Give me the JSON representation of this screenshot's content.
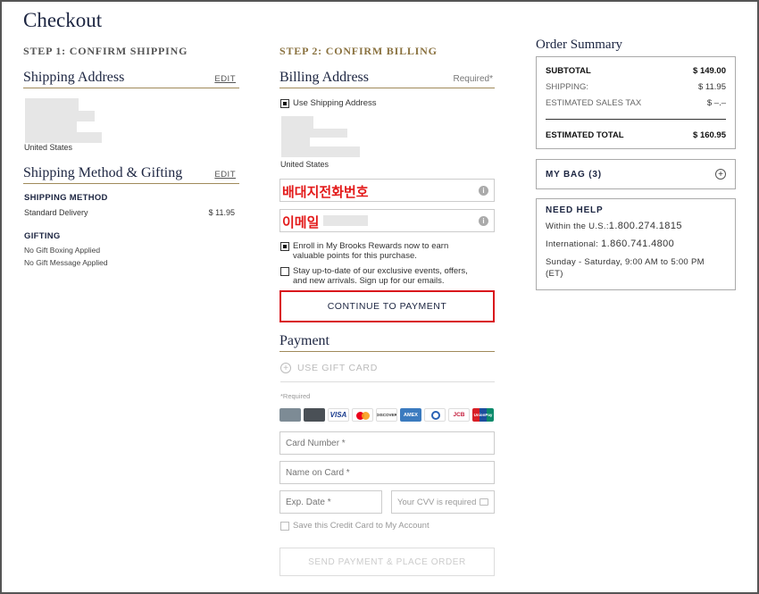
{
  "page": {
    "title": "Checkout"
  },
  "step1": {
    "title": "STEP 1: CONFIRM SHIPPING",
    "shipping_address": {
      "heading": "Shipping Address",
      "edit": "EDIT",
      "country": "United States"
    },
    "method_heading": "Shipping Method & Gifting",
    "method_edit": "EDIT",
    "shipping_method_label": "SHIPPING METHOD",
    "shipping_method_value": "Standard Delivery",
    "shipping_method_price": "$ 11.95",
    "gifting_label": "GIFTING",
    "gift_boxing": "No Gift Boxing Applied",
    "gift_message": "No Gift Message Applied"
  },
  "step2": {
    "title": "STEP 2: CONFIRM BILLING",
    "billing_heading": "Billing Address",
    "required_note": "Required*",
    "use_shipping": "Use Shipping Address",
    "country": "United States",
    "phone_overlay": "배대지전화번호",
    "email_overlay": "이메일",
    "info_icon_char": "i",
    "rewards_line1": "Enroll in My Brooks Rewards now to earn",
    "rewards_line2": "valuable points for this purchase.",
    "updates_line1": "Stay up-to-date of our exclusive events, offers,",
    "updates_line2": "and new arrivals. Sign up for our emails.",
    "continue_button": "CONTINUE TO PAYMENT",
    "payment_heading": "Payment",
    "gift_card": "USE GIFT CARD",
    "required_label": "*Required",
    "card_logos": [
      {
        "name": "card-1",
        "text": "",
        "color": "#7d8b95"
      },
      {
        "name": "card-2",
        "text": "",
        "color": "#555b60"
      },
      {
        "name": "visa",
        "text": "VISA",
        "color": "#ffffff"
      },
      {
        "name": "mastercard",
        "text": "",
        "color": "#ffffff"
      },
      {
        "name": "discover",
        "text": "DISCOVER",
        "color": "#ffffff"
      },
      {
        "name": "amex",
        "text": "AMEX",
        "color": "#3b7bbf"
      },
      {
        "name": "diners",
        "text": "",
        "color": "#ffffff"
      },
      {
        "name": "jcb",
        "text": "JCB",
        "color": "#ffffff"
      },
      {
        "name": "unionpay",
        "text": "UnionPay",
        "color": "#ffffff"
      }
    ],
    "card_number_placeholder": "Card Number *",
    "name_on_card_placeholder": "Name on Card *",
    "exp_date_placeholder": "Exp. Date *",
    "cvv_placeholder": "Your CVV is required",
    "save_card": "Save this Credit Card to My Account",
    "place_order_button": "SEND PAYMENT & PLACE ORDER"
  },
  "summary": {
    "heading": "Order Summary",
    "subtotal_label": "SUBTOTAL",
    "subtotal_value": "$ 149.00",
    "shipping_label": "SHIPPING:",
    "shipping_value": "$ 11.95",
    "tax_label": "ESTIMATED SALES TAX",
    "tax_value": "$ –.–",
    "total_label": "ESTIMATED TOTAL",
    "total_value": "$ 160.95",
    "bag_label": "MY BAG (3)",
    "help_heading": "NEED HELP",
    "us_label": "Within the U.S.:",
    "us_phone": "1.800.274.1815",
    "intl_label": "International:",
    "intl_phone": "1.860.741.4800",
    "hours_line1": "Sunday - Saturday, 9:00 AM to 5:00 PM",
    "hours_line2": "(ET)"
  },
  "colors": {
    "navy": "#1c2541",
    "gold": "#8a7240",
    "highlight_red": "#d9141c"
  }
}
